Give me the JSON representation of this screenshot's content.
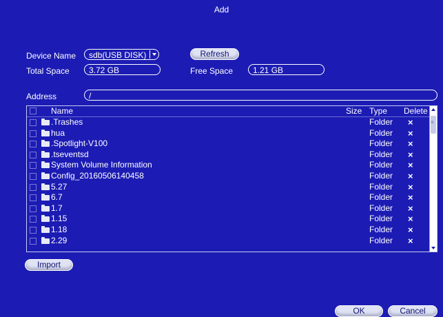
{
  "dialog": {
    "title": "Add"
  },
  "device": {
    "name_label": "Device Name",
    "name_value": "sdb(USB DISK)",
    "refresh_label": "Refresh",
    "total_label": "Total Space",
    "total_value": "3.72 GB",
    "free_label": "Free Space",
    "free_value": "1.21 GB"
  },
  "address": {
    "label": "Address",
    "value": "/"
  },
  "table": {
    "headers": {
      "name": "Name",
      "size": "Size",
      "type": "Type",
      "delete": "Delete"
    },
    "rows": [
      {
        "name": ".Trashes",
        "type": "Folder"
      },
      {
        "name": "hua",
        "type": "Folder"
      },
      {
        "name": ".Spotlight-V100",
        "type": "Folder"
      },
      {
        "name": ".tseventsd",
        "type": "Folder"
      },
      {
        "name": "System Volume Information",
        "type": "Folder"
      },
      {
        "name": "Config_20160506140458",
        "type": "Folder"
      },
      {
        "name": "5.27",
        "type": "Folder"
      },
      {
        "name": "6.7",
        "type": "Folder"
      },
      {
        "name": "1.7",
        "type": "Folder"
      },
      {
        "name": "1.15",
        "type": "Folder"
      },
      {
        "name": "1.18",
        "type": "Folder"
      },
      {
        "name": "2.29",
        "type": "Folder"
      }
    ],
    "delete_icon": "×"
  },
  "actions": {
    "import_label": "Import",
    "ok_label": "OK",
    "cancel_label": "Cancel"
  },
  "colors": {
    "background": "#1c1cb4",
    "button": "#dfe3f4"
  }
}
